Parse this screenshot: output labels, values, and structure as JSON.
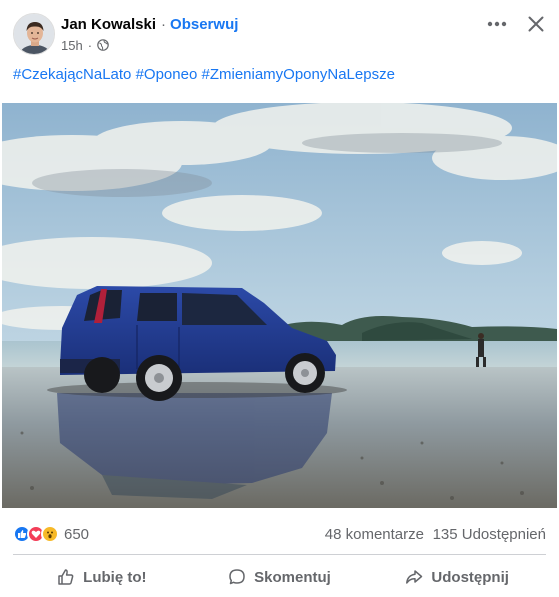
{
  "post": {
    "author": "Jan Kowalski",
    "separator": "·",
    "follow_label": "Obserwuj",
    "time": "15h",
    "meta_separator": "·",
    "privacy_icon": "globe-icon"
  },
  "header_actions": {
    "more_icon": "more-horizontal-icon",
    "close_icon": "close-icon"
  },
  "hashtags": [
    "#CzekającNaLato",
    "#Oponeo",
    "#ZmieniamyOponyNaLepsze"
  ],
  "reactions": {
    "icons": [
      "like-reaction-icon",
      "love-reaction-icon",
      "wow-reaction-icon"
    ],
    "count": "650",
    "comments": "48 komentarze",
    "shares": "135 Udostępnień"
  },
  "actions": {
    "like": "Lubię to!",
    "comment": "Skomentuj",
    "share": "Udostępnij"
  },
  "colors": {
    "link": "#1877f2",
    "secondary_text": "#65676b",
    "like_blue": "#1877f2",
    "love_red": "#f33e58",
    "wow_yellow": "#f7b928",
    "car_blue": "#1f3a8a"
  }
}
